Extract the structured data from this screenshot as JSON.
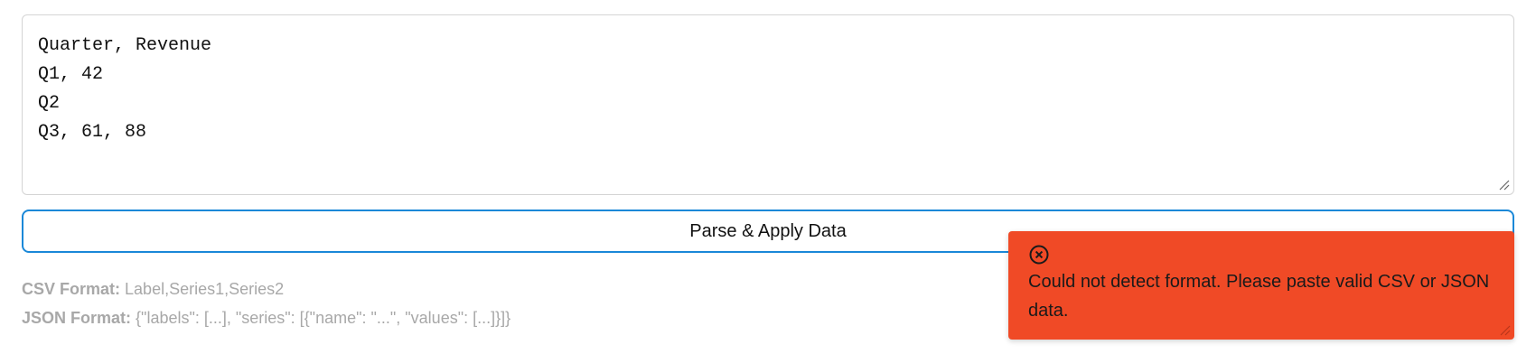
{
  "editor": {
    "content": "Quarter, Revenue\nQ1, 42\nQ2\nQ3, 61, 88"
  },
  "actions": {
    "parse_label": "Parse & Apply Data"
  },
  "help": {
    "csv_label": "CSV Format:",
    "csv_example": "Label,Series1,Series2",
    "json_label": "JSON Format:",
    "json_example": "{\"labels\": [...], \"series\": [{\"name\": \"...\", \"values\": [...]}]}"
  },
  "toast": {
    "icon": "error-circle-x-icon",
    "message": "Could not detect format. Please paste valid CSV or JSON data.",
    "color": "#f04a26"
  },
  "colors": {
    "button_border": "#1a88d8",
    "help_text": "#a8a8a8"
  }
}
